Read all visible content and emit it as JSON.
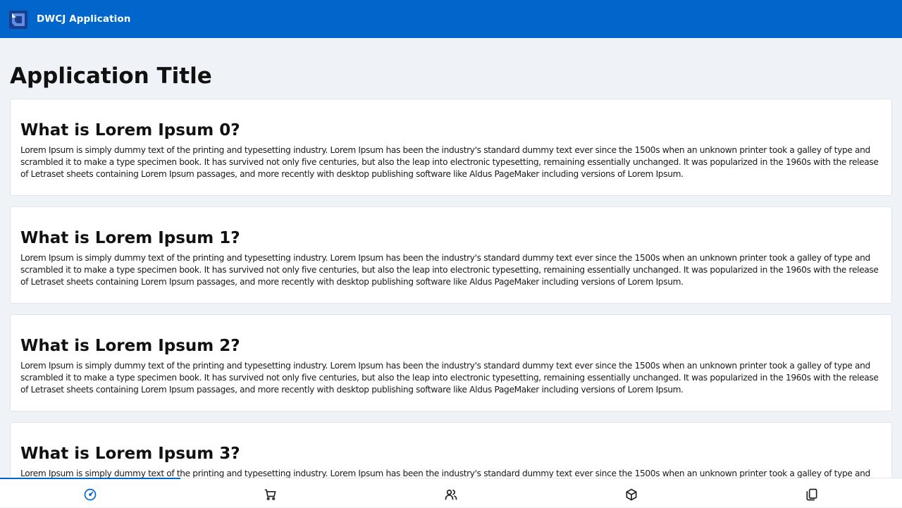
{
  "header": {
    "app_name": "DWCJ Application",
    "logo_icon": "dwcj-logo-icon",
    "background_color": "#0066cc"
  },
  "main": {
    "title": "Application Title",
    "cards": [
      {
        "title": "What is Lorem Ipsum 0?",
        "text": "Lorem Ipsum is simply dummy text of the printing and typesetting industry. Lorem Ipsum has been the industry's standard dummy text ever since the 1500s when an unknown printer took a galley of type and scrambled it to make a type specimen book. It has survived not only five centuries, but also the leap into electronic typesetting, remaining essentially unchanged. It was popularized in the 1960s with the release of Letraset sheets containing Lorem Ipsum passages, and more recently with desktop publishing software like Aldus PageMaker including versions of Lorem Ipsum."
      },
      {
        "title": "What is Lorem Ipsum 1?",
        "text": "Lorem Ipsum is simply dummy text of the printing and typesetting industry. Lorem Ipsum has been the industry's standard dummy text ever since the 1500s when an unknown printer took a galley of type and scrambled it to make a type specimen book. It has survived not only five centuries, but also the leap into electronic typesetting, remaining essentially unchanged. It was popularized in the 1960s with the release of Letraset sheets containing Lorem Ipsum passages, and more recently with desktop publishing software like Aldus PageMaker including versions of Lorem Ipsum."
      },
      {
        "title": "What is Lorem Ipsum 2?",
        "text": "Lorem Ipsum is simply dummy text of the printing and typesetting industry. Lorem Ipsum has been the industry's standard dummy text ever since the 1500s when an unknown printer took a galley of type and scrambled it to make a type specimen book. It has survived not only five centuries, but also the leap into electronic typesetting, remaining essentially unchanged. It was popularized in the 1960s with the release of Letraset sheets containing Lorem Ipsum passages, and more recently with desktop publishing software like Aldus PageMaker including versions of Lorem Ipsum."
      },
      {
        "title": "What is Lorem Ipsum 3?",
        "text": "Lorem Ipsum is simply dummy text of the printing and typesetting industry. Lorem Ipsum has been the industry's standard dummy text ever since the 1500s when an unknown printer took a galley of type and scrambled it to make a type specimen book. It has survived not only five centuries, but also the leap into electronic typesetting, remaining essentially unchanged. It was popularized in the 1960s with the release of Letraset sheets containing Lorem Ipsum passages, and more recently with desktop publishing software like Aldus PageMaker including versions of Lorem Ipsum."
      }
    ]
  },
  "bottom_nav": {
    "active_index": 0,
    "accent_color": "#0066cc",
    "items": [
      {
        "icon": "dashboard-gauge-icon"
      },
      {
        "icon": "shopping-cart-icon"
      },
      {
        "icon": "users-icon"
      },
      {
        "icon": "box-icon"
      },
      {
        "icon": "documents-icon"
      }
    ]
  }
}
